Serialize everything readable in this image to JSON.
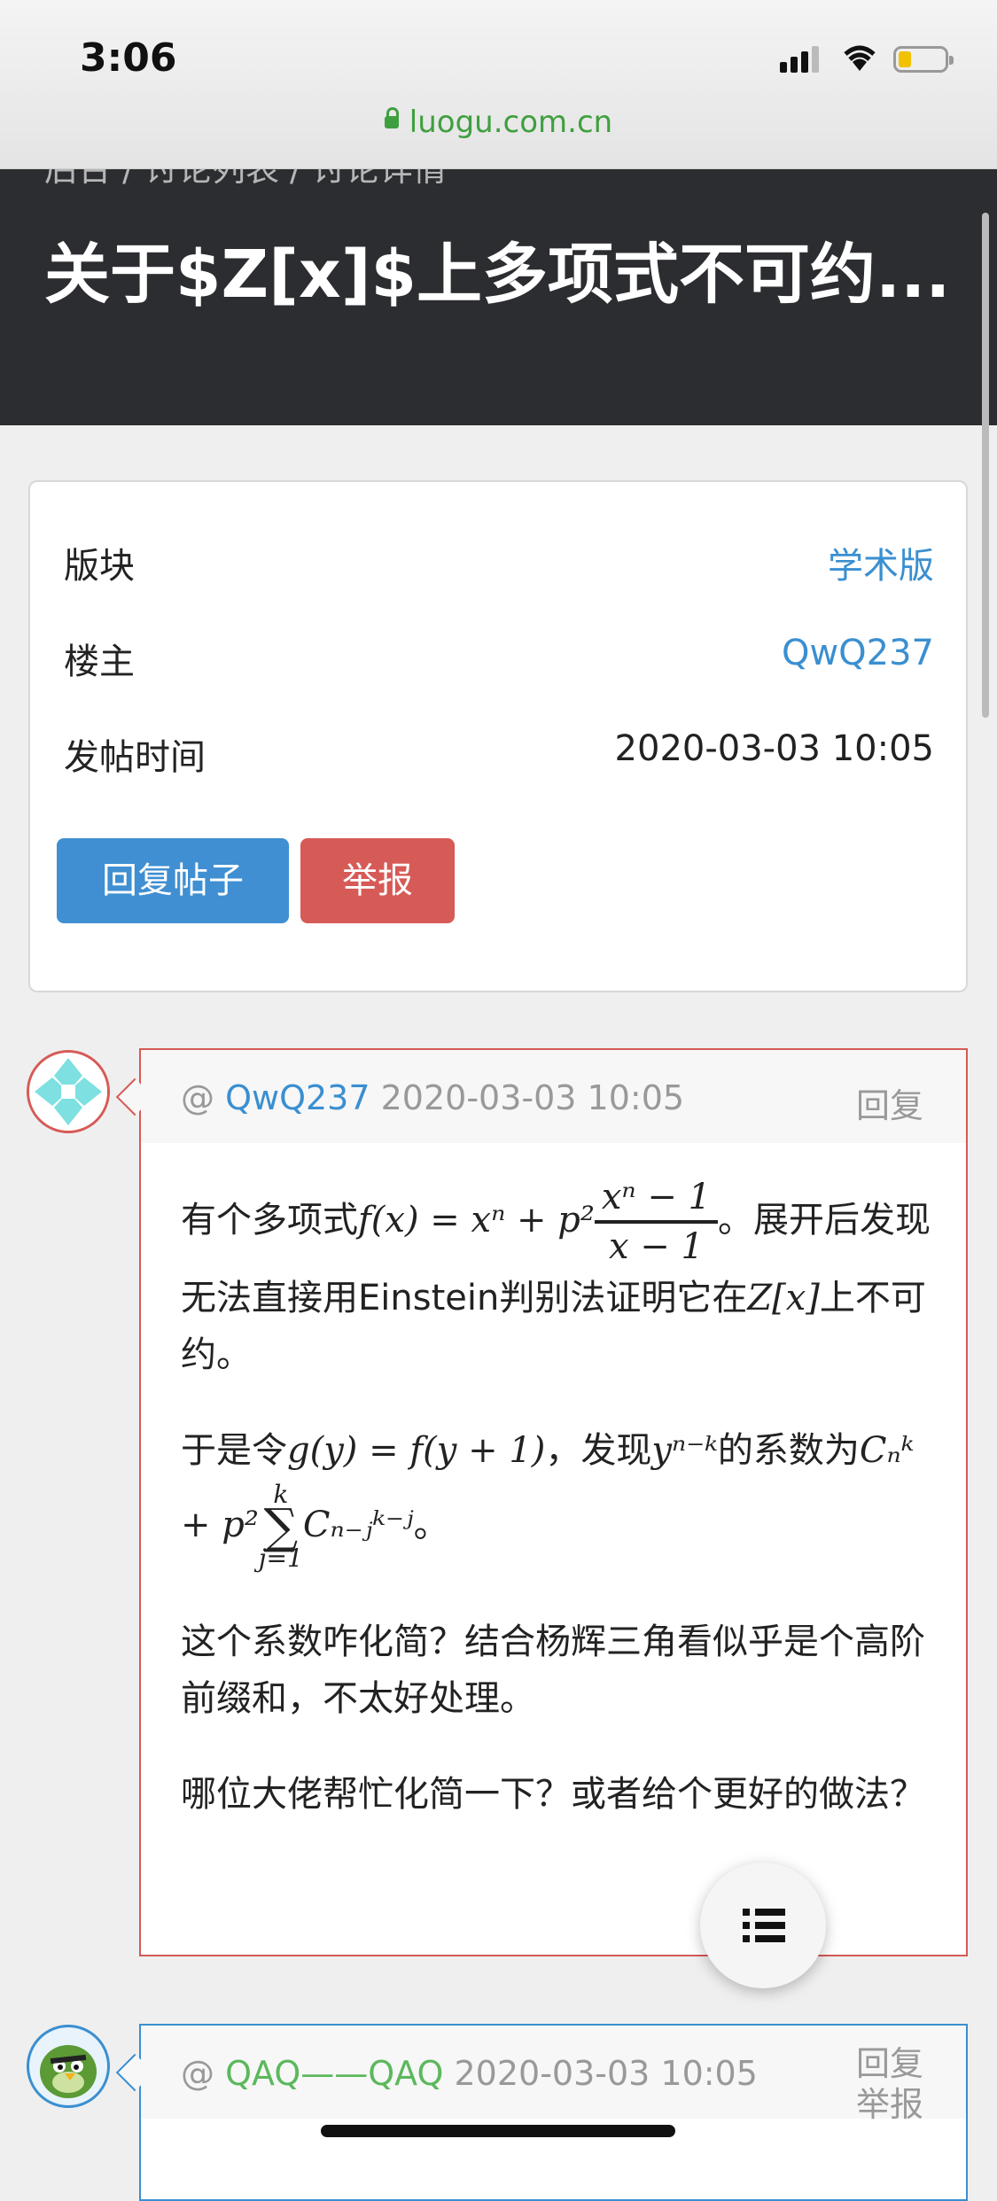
{
  "status_bar": {
    "time": "3:06",
    "url": "luogu.com.cn"
  },
  "header": {
    "breadcrumb": "后台 / 讨论列表 / 讨论详情",
    "title": "关于$Z[x]$上多项式不可约..."
  },
  "info_card": {
    "rows": [
      {
        "label": "版块",
        "value": "学术版"
      },
      {
        "label": "楼主",
        "value": "QwQ237"
      },
      {
        "label": "发帖时间",
        "value": "2020-03-03 10:05"
      }
    ],
    "reply_button": "回复帖子",
    "report_button": "举报"
  },
  "posts": [
    {
      "at": "@",
      "author": "QwQ237",
      "time": "2020-03-03 10:05",
      "reply": "回复",
      "content": {
        "p1_a": "有个多项式",
        "p1_math": "f(x) = xⁿ + p²",
        "p1_num": "xⁿ − 1",
        "p1_den": "x − 1",
        "p1_b": "。展开后发现无法直接用Einstein判别法证明它在",
        "p1_zx": "Z[x]",
        "p1_c": "上不可约。",
        "p2_a": "于是令",
        "p2_math1": "g(y) = f(y + 1)",
        "p2_b": "，发现",
        "p2_math2": "yⁿ⁻ᵏ",
        "p2_c": "的系数为",
        "p2_math3": "Cₙᵏ + p²",
        "p2_sum_top": "k",
        "p2_sum_bot": "j=1",
        "p2_math4": "Cₙ₋ⱼᵏ⁻ʲ",
        "p2_d": "。",
        "p3": "这个系数咋化简？结合杨辉三角看似乎是个高阶前缀和，不太好处理。",
        "p4": "哪位大佬帮忙化简一下？或者给个更好的做法？"
      }
    },
    {
      "at": "@",
      "author": "QAQ——QAQ",
      "time": "2020-03-03 10:05",
      "reply": "回复",
      "report": "举报"
    }
  ],
  "colors": {
    "link": "#3a8fd0",
    "danger": "#d65a56",
    "green_user": "#5cb85c",
    "header_bg": "#2b2d30"
  }
}
